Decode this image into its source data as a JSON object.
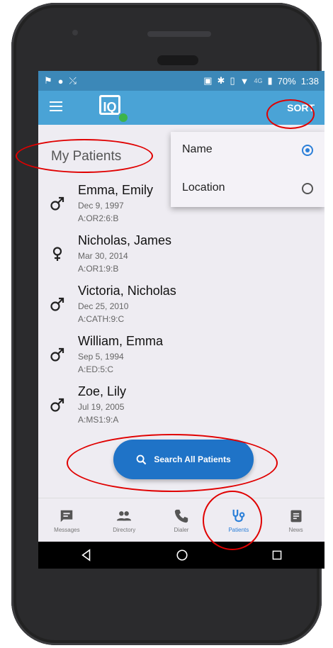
{
  "status": {
    "battery": "70%",
    "time": "1:38",
    "network": "4G"
  },
  "appbar": {
    "logo_text": "IQ",
    "sort_label": "SORT"
  },
  "page": {
    "title": "My Patients"
  },
  "patients": [
    {
      "name": "Emma, Emily",
      "dob": "Dec 9, 1997",
      "location": "A:OR2:6:B",
      "gender": "male"
    },
    {
      "name": "Nicholas, James",
      "dob": "Mar 30, 2014",
      "location": "A:OR1:9:B",
      "gender": "female"
    },
    {
      "name": "Victoria, Nicholas",
      "dob": "Dec 25, 2010",
      "location": "A:CATH:9:C",
      "gender": "male"
    },
    {
      "name": "William, Emma",
      "dob": "Sep 5, 1994",
      "location": "A:ED:5:C",
      "gender": "male"
    },
    {
      "name": "Zoe, Lily",
      "dob": "Jul 19, 2005",
      "location": "A:MS1:9:A",
      "gender": "male"
    }
  ],
  "sort_menu": {
    "options": [
      {
        "label": "Name",
        "selected": true
      },
      {
        "label": "Location",
        "selected": false
      }
    ]
  },
  "search_button": {
    "label": "Search All Patients"
  },
  "bottom_nav": [
    {
      "label": "Messages",
      "icon": "message-icon"
    },
    {
      "label": "Directory",
      "icon": "people-icon"
    },
    {
      "label": "Dialer",
      "icon": "phone-icon"
    },
    {
      "label": "Patients",
      "icon": "stethoscope-icon",
      "active": true
    },
    {
      "label": "News",
      "icon": "news-icon"
    }
  ],
  "colors": {
    "appbar": "#4aa3d6",
    "accent": "#1f73c7",
    "annotation": "#e00000"
  }
}
